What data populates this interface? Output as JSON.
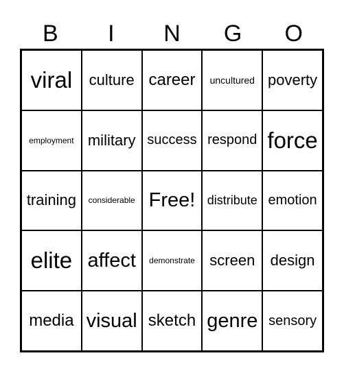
{
  "header": [
    "B",
    "I",
    "N",
    "G",
    "O"
  ],
  "cells": [
    [
      "viral",
      "culture",
      "career",
      "uncultured",
      "poverty"
    ],
    [
      "employment",
      "military",
      "success",
      "respond",
      "force"
    ],
    [
      "training",
      "considerable",
      "Free!",
      "distribute",
      "emotion"
    ],
    [
      "elite",
      "affect",
      "demonstrate",
      "screen",
      "design"
    ],
    [
      "media",
      "visual",
      "sketch",
      "genre",
      "sensory"
    ]
  ]
}
